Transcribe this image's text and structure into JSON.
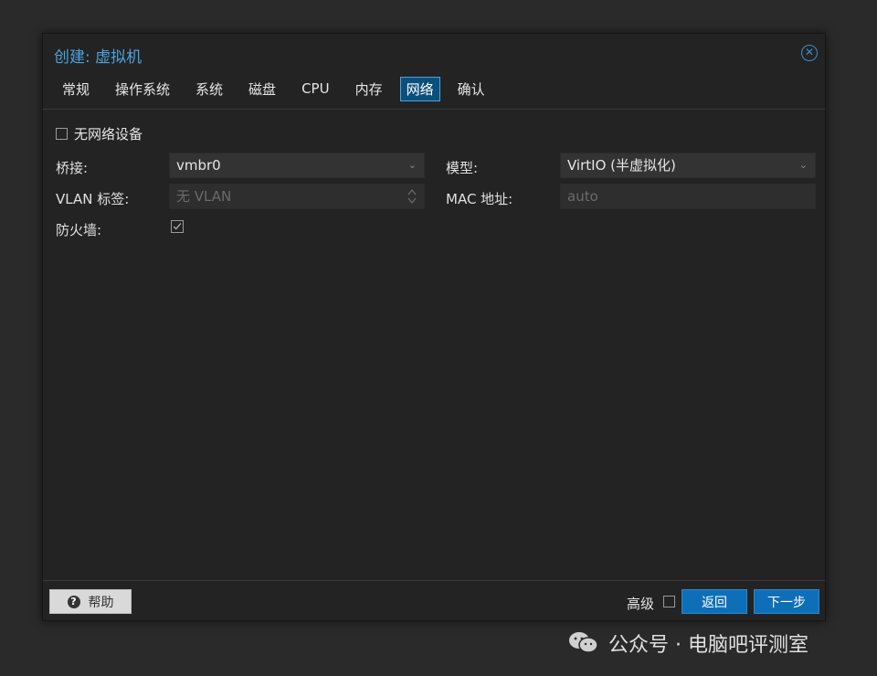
{
  "dialog": {
    "title": "创建: 虚拟机",
    "close_icon": "close-circle-icon"
  },
  "tabs": [
    {
      "label": "常规",
      "active": false
    },
    {
      "label": "操作系统",
      "active": false
    },
    {
      "label": "系统",
      "active": false
    },
    {
      "label": "磁盘",
      "active": false
    },
    {
      "label": "CPU",
      "active": false
    },
    {
      "label": "内存",
      "active": false
    },
    {
      "label": "网络",
      "active": true
    },
    {
      "label": "确认",
      "active": false
    }
  ],
  "form": {
    "no_network_label": "无网络设备",
    "no_network_checked": false,
    "bridge_label": "桥接:",
    "bridge_value": "vmbr0",
    "vlan_label": "VLAN 标签:",
    "vlan_placeholder": "无 VLAN",
    "firewall_label": "防火墙:",
    "firewall_checked": true,
    "model_label": "模型:",
    "model_value": "VirtIO (半虚拟化)",
    "mac_label": "MAC 地址:",
    "mac_placeholder": "auto"
  },
  "footer": {
    "help_label": "帮助",
    "advanced_label": "高级",
    "advanced_checked": false,
    "back_label": "返回",
    "next_label": "下一步"
  },
  "watermark": {
    "text": "公众号 · 电脑吧评测室",
    "icon": "wechat-icon"
  },
  "colors": {
    "accent": "#4aa3df",
    "primary_button": "#0e6fb8",
    "background": "#232323"
  }
}
